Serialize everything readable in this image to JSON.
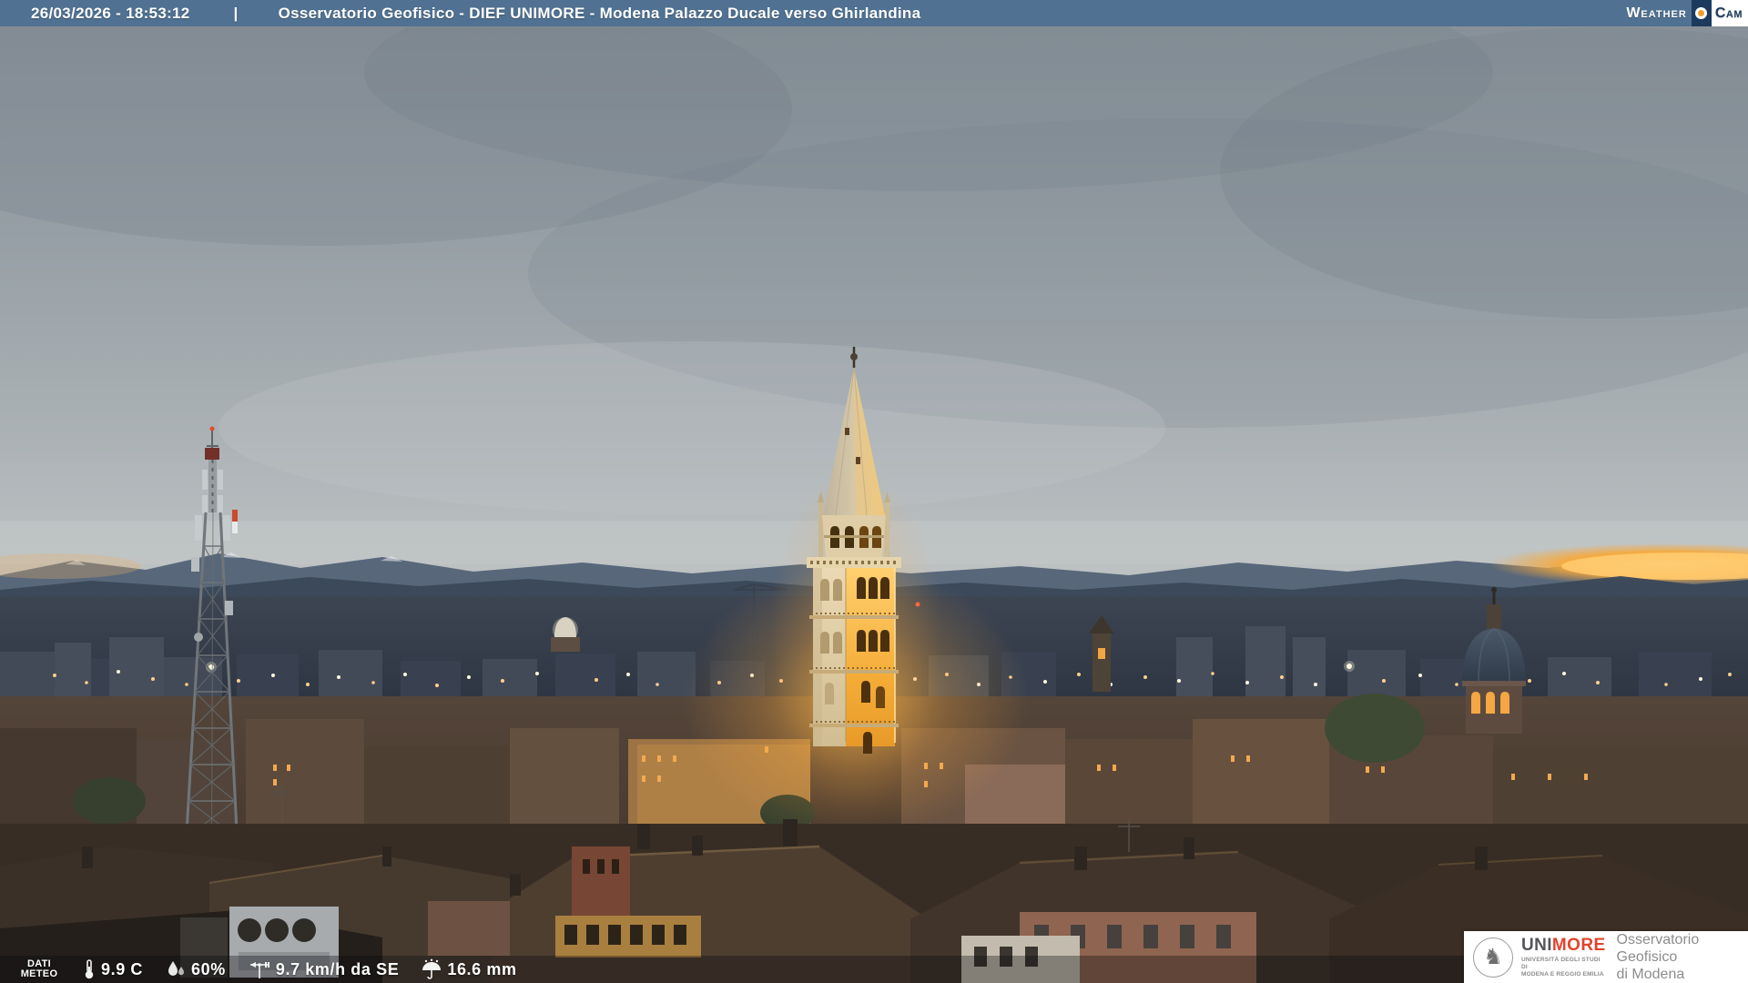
{
  "header": {
    "datetime": "26/03/2026 - 18:53:12",
    "separator": "|",
    "title": "Osservatorio Geofisico - DIEF UNIMORE - Modena Palazzo Ducale verso Ghirlandina"
  },
  "logo": {
    "weather": "Weather",
    "cam": "Cam"
  },
  "meteo": {
    "label_top": "DATI",
    "label_bottom": "METEO",
    "temperature": "9.9 C",
    "humidity": "60%",
    "wind": "9.7 km/h da SE",
    "rain": "16.6 mm"
  },
  "branding": {
    "uni": "UNI",
    "more": "MORE",
    "dept_line1": "UNIVERSITÀ DEGLI STUDI DI",
    "dept_line2": "MODENA E REGGIO EMILIA",
    "obs_line1": "Osservatorio Geofisico",
    "obs_line2": "di Modena"
  },
  "colors": {
    "header_bg": "#507191",
    "weathercam_navy": "#1c3a5e",
    "weathercam_dot": "#f39c2d",
    "unimore_red": "#e0442b",
    "sky_top": "#868f97",
    "sky_horizon": "#c2c5c4",
    "sunset_glow": "#f7a93c",
    "mountains": "#3a4859",
    "tower_light": "#f5ad38"
  }
}
